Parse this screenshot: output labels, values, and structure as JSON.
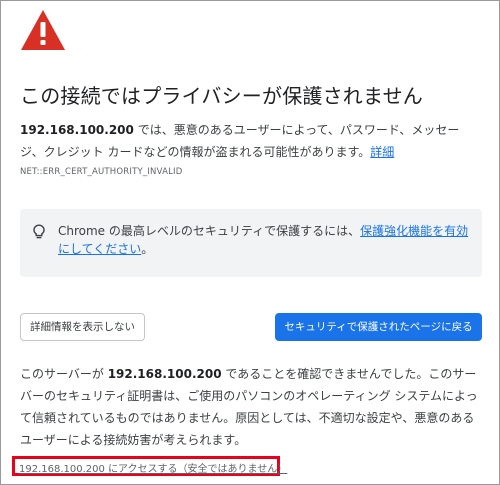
{
  "warning": {
    "icon": "warning-triangle-icon",
    "color": "#d93025"
  },
  "title": "この接続ではプライバシーが保護されません",
  "description": {
    "host": "192.168.100.200",
    "text_after_host": " では、悪意のあるユーザーによって、パスワード、メッセージ、クレジット カードなどの情報が盗まれる可能性があります。",
    "learn_more": "詳細"
  },
  "error_code": "NET::ERR_CERT_AUTHORITY_INVALID",
  "info_box": {
    "icon": "lightbulb-icon",
    "text_before_link": "Chrome の最高レベルのセキュリティで保護するには、",
    "link": "保護強化機能を有効にしてください",
    "text_after_link": "。"
  },
  "buttons": {
    "details": "詳細情報を表示しない",
    "back_to_safety": "セキュリティで保護されたページに戻る"
  },
  "explanation": {
    "text_before_host": "このサーバーが ",
    "host": "192.168.100.200",
    "text_after_host": " であることを確認できませんでした。このサーバーのセキュリティ証明書は、ご使用のパソコンのオペレーティング システムによって信頼されているものではありません。原因としては、不適切な設定や、悪意のあるユーザーによる接続妨害が考えられます。"
  },
  "proceed_link": "192.168.100.200 にアクセスする（安全ではありません）",
  "colors": {
    "accent": "#1a73e8",
    "warning_red": "#d93025",
    "highlight_border": "#e8001c",
    "info_bg": "#f1f3f4"
  }
}
